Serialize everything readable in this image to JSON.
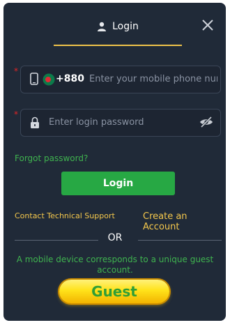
{
  "header": {
    "tab_label": "Login"
  },
  "phone": {
    "country_code": "+880",
    "placeholder": "Enter your mobile phone number",
    "value": ""
  },
  "password": {
    "placeholder": "Enter login password",
    "value": ""
  },
  "links": {
    "forgot_password": "Forgot password?",
    "contact_support": "Contact Technical Support",
    "create_account": "Create an Account"
  },
  "buttons": {
    "login": "Login",
    "guest": "Guest"
  },
  "divider_label": "OR",
  "guest_note": "A mobile device corresponds to a unique guest account.",
  "colors": {
    "panel_bg": "#202a38",
    "accent_gold": "#f5c84c",
    "green": "#27a844",
    "required_star": "#e02525"
  },
  "icons": [
    "user-icon",
    "close-icon",
    "phone-icon",
    "bangladesh-flag-icon",
    "lock-icon",
    "eye-slash-icon"
  ]
}
